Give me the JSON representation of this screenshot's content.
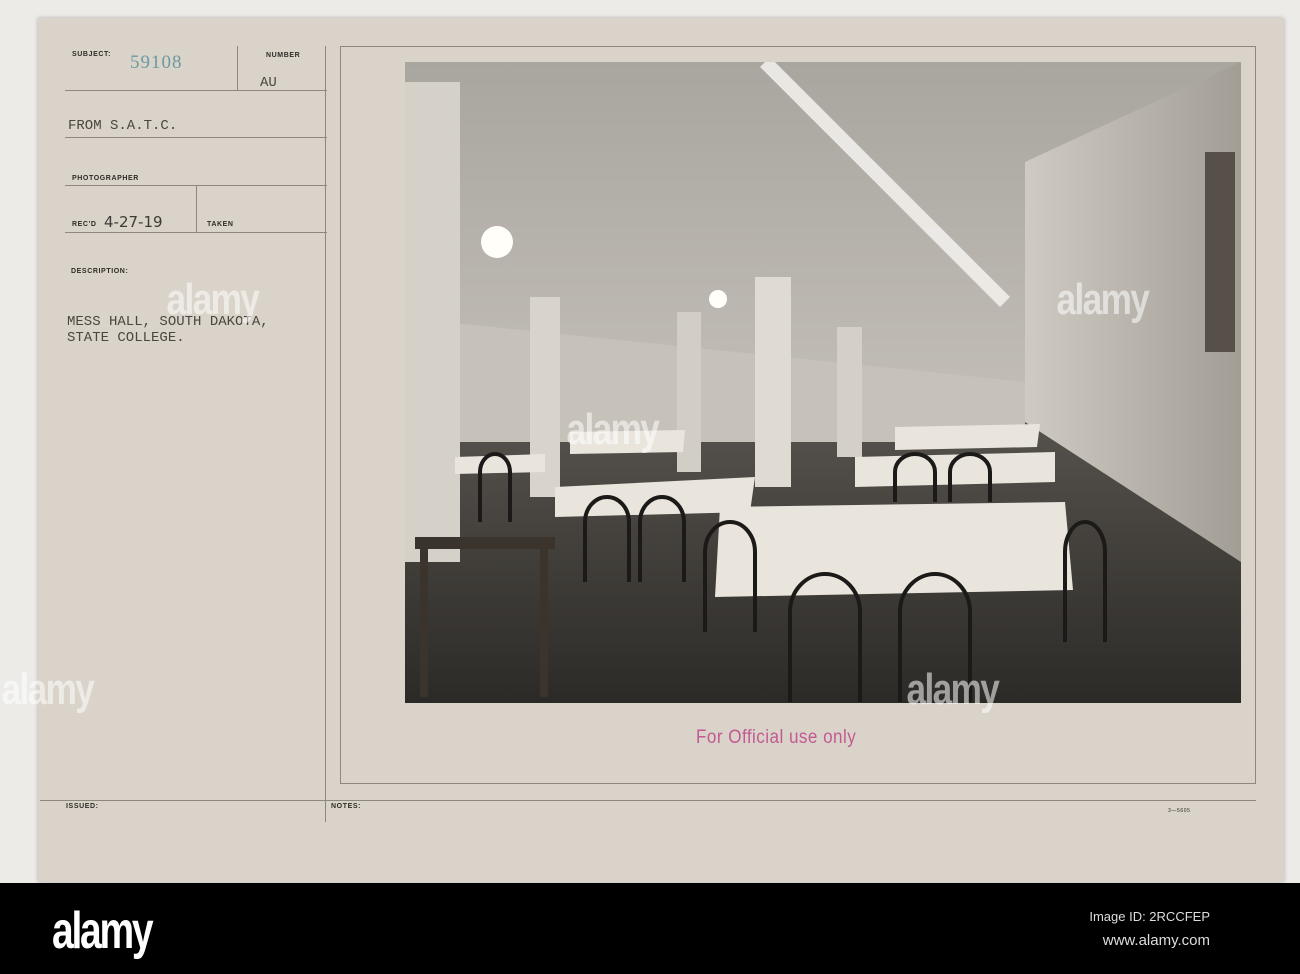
{
  "card": {
    "subject_label": "SUBJECT:",
    "subject_number": "59108",
    "number_label": "NUMBER",
    "number_value": "AU",
    "from": "FROM S.A.T.C.",
    "photographer_label": "PHOTOGRAPHER",
    "recd_label": "REC'D",
    "recd_date": "4-27-19",
    "taken_label": "TAKEN",
    "description_label": "DESCRIPTION:",
    "description_line1": "MESS HALL, SOUTH DAKOTA,",
    "description_line2": "STATE COLLEGE.",
    "issued_label": "ISSUED:",
    "notes_label": "NOTES:",
    "form_number": "3—5605",
    "stamp": "For Official use only"
  },
  "watermark": {
    "text": "alamy"
  },
  "footer": {
    "logo": "alamy",
    "image_id": "Image ID: 2RCCFEP",
    "url": "www.alamy.com"
  }
}
